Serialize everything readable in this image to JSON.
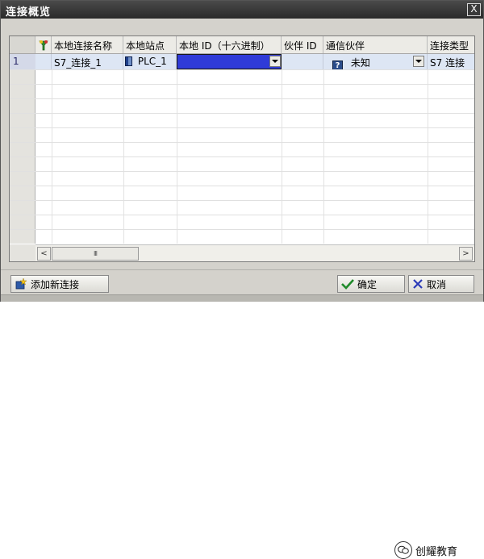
{
  "window": {
    "title": "连接概览",
    "close_glyph": "X"
  },
  "table": {
    "columns": [
      {
        "label": ""
      },
      {
        "label": "",
        "icon": "connection-status-icon"
      },
      {
        "label": "本地连接名称"
      },
      {
        "label": "本地站点"
      },
      {
        "label": "本地 ID（十六进制）"
      },
      {
        "label": "伙伴 ID"
      },
      {
        "label": "通信伙伴"
      },
      {
        "label": "连接类型"
      }
    ],
    "rows": [
      {
        "row_number": "1",
        "local_connection_name": "S7_连接_1",
        "local_station": "PLC_1",
        "local_id_hex": "",
        "partner_id": "",
        "comm_partner": "未知",
        "connection_type": "S7 连接"
      }
    ]
  },
  "scrollbar": {
    "left_glyph": "<",
    "right_glyph": ">",
    "thumb_grip": "III"
  },
  "buttons": {
    "add_connection": "添加新连接",
    "ok": "确定",
    "cancel": "取消"
  },
  "watermark": {
    "text": "创耀教育"
  },
  "colors": {
    "title_bar": "#2f2f2f",
    "selection": "#2f3bd8",
    "row_highlight": "#dde6f4",
    "window_bg": "#d4d2cc"
  }
}
